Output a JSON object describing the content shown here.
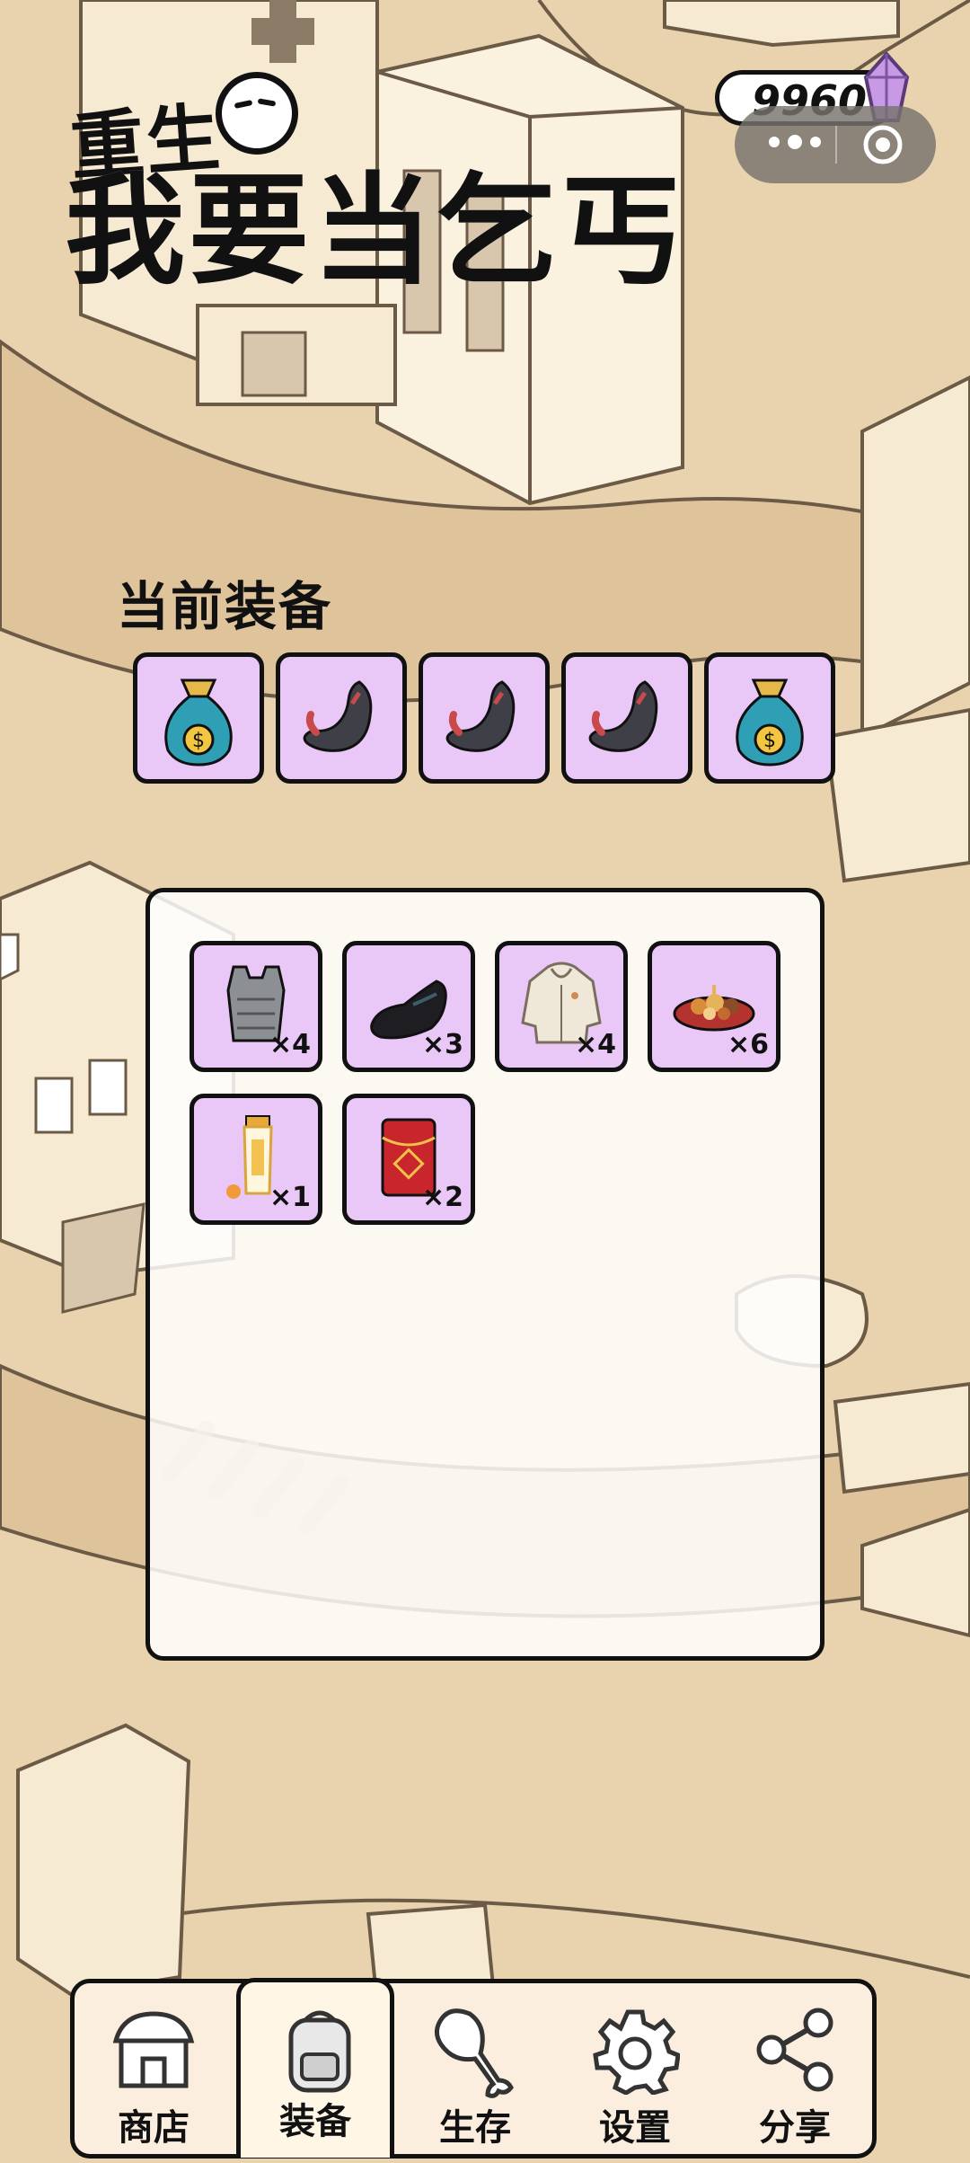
{
  "game": {
    "title_line1": "重生",
    "title_line2": "我要当乞丐"
  },
  "currency": {
    "amount": "9960",
    "icon": "purple-crystal-icon"
  },
  "miniprogram_capsule": {
    "more_icon": "more-dots-icon",
    "close_icon": "close-circle-icon"
  },
  "equipment": {
    "title": "当前装备",
    "slots": [
      {
        "item": "money-bag-icon"
      },
      {
        "item": "stomach-icon"
      },
      {
        "item": "stomach-icon"
      },
      {
        "item": "stomach-icon"
      },
      {
        "item": "money-bag-icon"
      }
    ]
  },
  "inventory": {
    "items": [
      {
        "item": "body-armor-icon",
        "count": "×4"
      },
      {
        "item": "cloth-shoes-icon",
        "count": "×3"
      },
      {
        "item": "hoodie-icon",
        "count": "×4"
      },
      {
        "item": "food-platter-icon",
        "count": "×6"
      },
      {
        "item": "sunscreen-tube-icon",
        "count": "×1"
      },
      {
        "item": "red-envelope-icon",
        "count": "×2"
      }
    ]
  },
  "nav": {
    "items": [
      {
        "label": "商店",
        "icon": "shop-icon"
      },
      {
        "label": "装备",
        "icon": "backpack-icon"
      },
      {
        "label": "生存",
        "icon": "chicken-leg-icon"
      },
      {
        "label": "设置",
        "icon": "gear-icon"
      },
      {
        "label": "分享",
        "icon": "share-icon"
      }
    ],
    "active": "装备"
  },
  "colors": {
    "background": "#e9d2ae",
    "slot_fill": "#e9c7f7",
    "outline": "#111111"
  }
}
